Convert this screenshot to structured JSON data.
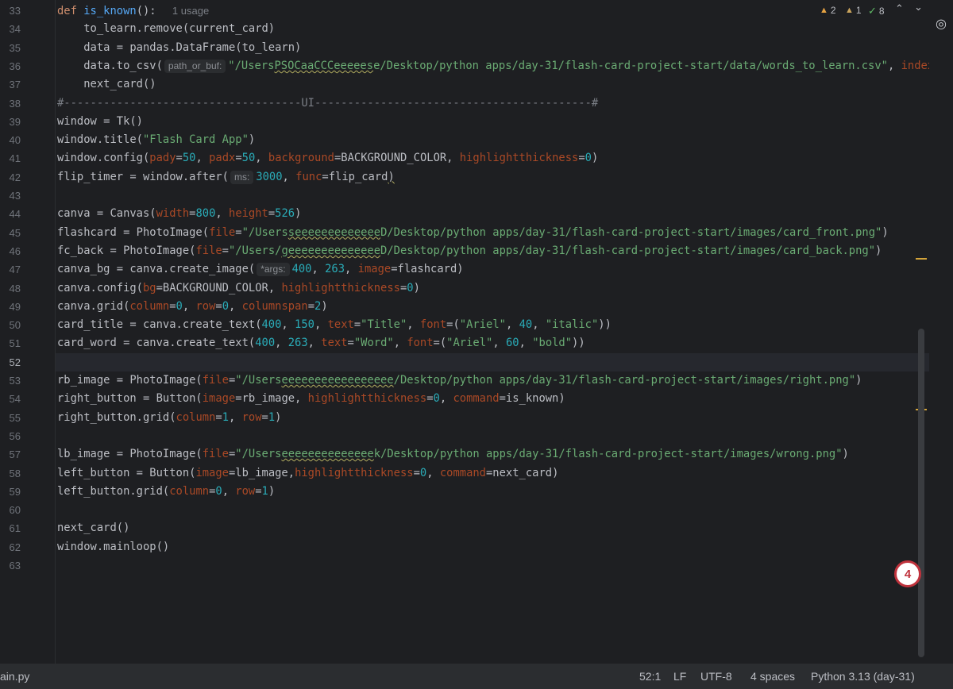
{
  "editor": {
    "lines": [
      {
        "n": "33",
        "html": "<span class='kw'>def </span><span class='fn'>is_known</span>(): <span class='usage'>1 usage</span>"
      },
      {
        "n": "34",
        "html": "    to_learn.remove(current_card)"
      },
      {
        "n": "35",
        "html": "    data = pandas.DataFrame(to_learn)"
      },
      {
        "n": "36",
        "html": "    data.to_csv(<span class='hint'>path_or_buf:</span><span class='str'>\"/Users<span class='squig'>PSOCaaCCCeeeees</span>e/Desktop/python apps/day-31/flash-card-project-start/data/words_to_learn.csv\"</span>, <span class='kwarg'>index</span>"
      },
      {
        "n": "37",
        "html": "    next_card()"
      },
      {
        "n": "38",
        "html": "<span class='cmt'>#------------------------------------UI------------------------------------------#</span>"
      },
      {
        "n": "39",
        "html": "window = Tk()"
      },
      {
        "n": "40",
        "html": "window.title(<span class='str'>\"Flash Card App\"</span>)"
      },
      {
        "n": "41",
        "html": "window.config(<span class='kwarg'>pady</span>=<span class='num'>50</span>, <span class='kwarg'>padx</span>=<span class='num'>50</span>, <span class='kwarg'>background</span>=BACKGROUND_COLOR, <span class='kwarg'>highlightthickness</span>=<span class='num'>0</span>)"
      },
      {
        "n": "42",
        "html": "flip_timer = window.after(<span class='hint'>ms:</span><span class='num'>3000</span>, <span class='kwarg'>func</span>=flip_card<span class='squig'>)</span>"
      },
      {
        "n": "43",
        "html": ""
      },
      {
        "n": "44",
        "html": "canva = Canvas(<span class='kwarg'>width</span>=<span class='num'>800</span>, <span class='kwarg'>height</span>=<span class='num'>526</span>)"
      },
      {
        "n": "45",
        "html": "flashcard = PhotoImage(<span class='kwarg'>file</span>=<span class='str'>\"/Users<span class='squig'>seeeeeeeeeeeee</span>D/Desktop/python apps/day-31/flash-card-project-start/images/card_front.png\"</span>)"
      },
      {
        "n": "46",
        "html": "fc_back = PhotoImage(<span class='kwarg'>file</span>=<span class='str'>\"/Users/<span class='squig'>geeeeeeeeeeeeee</span>D/Desktop/python apps/day-31/flash-card-project-start/images/card_back.png\"</span>)"
      },
      {
        "n": "47",
        "html": "canva_bg = canva.create_image(<span class='hint'>*args:</span><span class='num'>400</span>, <span class='num'>263</span>, <span class='kwarg'>image</span>=flashcard)"
      },
      {
        "n": "48",
        "html": "canva.config(<span class='kwarg'>bg</span>=BACKGROUND_COLOR, <span class='kwarg'>highlightthickness</span>=<span class='num'>0</span>)"
      },
      {
        "n": "49",
        "html": "canva.grid(<span class='kwarg'>column</span>=<span class='num'>0</span>, <span class='kwarg'>row</span>=<span class='num'>0</span>, <span class='kwarg'>columnspan</span>=<span class='num'>2</span>)"
      },
      {
        "n": "50",
        "html": "card_title = canva.create_text(<span class='num'>400</span>, <span class='num'>150</span>, <span class='kwarg'>text</span>=<span class='str'>\"Title\"</span>, <span class='kwarg'>font</span>=(<span class='str'>\"Ariel\"</span>, <span class='num'>40</span>, <span class='str'>\"italic\"</span>))"
      },
      {
        "n": "51",
        "html": "card_word = canva.create_text(<span class='num'>400</span>, <span class='num'>263</span>, <span class='kwarg'>text</span>=<span class='str'>\"Word\"</span>, <span class='kwarg'>font</span>=(<span class='str'>\"Ariel\"</span>, <span class='num'>60</span>, <span class='str'>\"bold\"</span>))"
      },
      {
        "n": "52",
        "html": "",
        "current": true
      },
      {
        "n": "53",
        "html": "rb_image = PhotoImage(<span class='kwarg'>file</span>=<span class='str'>\"/Users<span class='squig'>eeeeeeeeeeeeeeeee</span>/Desktop/python apps/day-31/flash-card-project-start/images/right.png\"</span>)"
      },
      {
        "n": "54",
        "html": "right_button = Button(<span class='kwarg'>image</span>=rb_image, <span class='kwarg'>highlightthickness</span>=<span class='num'>0</span>, <span class='kwarg'>command</span>=is_known)"
      },
      {
        "n": "55",
        "html": "right_button.grid(<span class='kwarg'>column</span>=<span class='num'>1</span>, <span class='kwarg'>row</span>=<span class='num'>1</span>)"
      },
      {
        "n": "56",
        "html": ""
      },
      {
        "n": "57",
        "html": "lb_image = PhotoImage(<span class='kwarg'>file</span>=<span class='str'>\"/Users<span class='squig'>eeeeeeeeeeeeee</span>k/Desktop/python apps/day-31/flash-card-project-start/images/wrong.png\"</span>)"
      },
      {
        "n": "58",
        "html": "left_button = Button(<span class='kwarg'>image</span>=lb_image,<span class='kwarg'>highlightthickness</span>=<span class='num'>0</span>, <span class='kwarg'>command</span>=next_card)"
      },
      {
        "n": "59",
        "html": "left_button.grid(<span class='kwarg'>column</span>=<span class='num'>0</span>, <span class='kwarg'>row</span>=<span class='num'>1</span>)"
      },
      {
        "n": "60",
        "html": ""
      },
      {
        "n": "61",
        "html": "next_card()"
      },
      {
        "n": "62",
        "html": "window.mainloop()"
      },
      {
        "n": "63",
        "html": ""
      }
    ]
  },
  "inspections": {
    "warnings": "2",
    "weak_warnings": "1",
    "typos": "8"
  },
  "badge": {
    "count": "4"
  },
  "status": {
    "file": "ain.py",
    "position": "52:1",
    "line_sep": "LF",
    "encoding": "UTF-8",
    "indent": "4 spaces",
    "interpreter": "Python 3.13 (day-31)"
  },
  "colors": {
    "editor_bg": "#1e1f22",
    "keyword": "#cf8e6d",
    "string": "#6aab73",
    "number": "#2aacb8",
    "kwarg": "#aa4926",
    "function": "#56a8f5"
  }
}
